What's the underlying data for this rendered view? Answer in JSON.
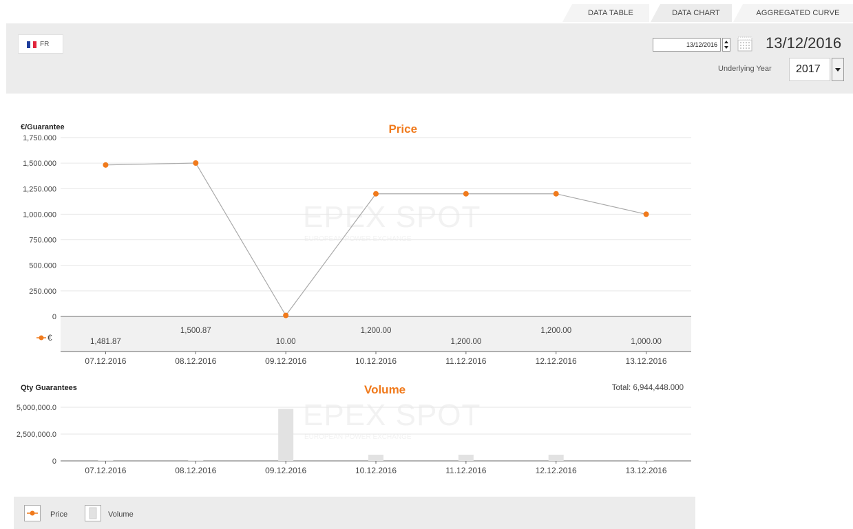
{
  "tabs": [
    "DATA TABLE",
    "DATA CHART",
    "AGGREGATED CURVE"
  ],
  "toolbar": {
    "country": "FR",
    "date_input": "13/12/2016",
    "date_display": "13/12/2016",
    "underlying_year_label": "Underlying Year",
    "underlying_year": "2017"
  },
  "colors": {
    "price": "#f07a1c",
    "volume": "#e2e2e2",
    "title": "#f07a1c"
  },
  "watermark": {
    "line1": "EPEX SPOT",
    "line2": "EUROPEAN POWER EXCHANGE"
  },
  "legend": {
    "price": "Price",
    "volume": "Volume"
  },
  "chart_data": [
    {
      "type": "line",
      "title": "Price",
      "ylabel": "€/Guarantee",
      "ylim": [
        0,
        1750
      ],
      "yticks": [
        "1,750.000",
        "1,500.000",
        "1,250.000",
        "1,000.000",
        "750.000",
        "500.000",
        "250.000",
        "0"
      ],
      "categories": [
        "07.12.2016",
        "08.12.2016",
        "09.12.2016",
        "10.12.2016",
        "11.12.2016",
        "12.12.2016",
        "13.12.2016"
      ],
      "series": [
        {
          "symbol": "€",
          "values": [
            1481.87,
            1500.87,
            10.0,
            1200.0,
            1200.0,
            1200.0,
            1000.0
          ],
          "labels": [
            "1,481.87",
            "1,500.87",
            "10.00",
            "1,200.00",
            "1,200.00",
            "1,200.00",
            "1,000.00"
          ]
        }
      ],
      "grid": true
    },
    {
      "type": "bar",
      "title": "Volume",
      "ylabel": "Qty Guarantees",
      "total_label": "Total: 6,944,448.000",
      "ylim": [
        0,
        5000000
      ],
      "yticks": [
        "5,000,000.0",
        "2,500,000.0",
        "0"
      ],
      "categories": [
        "07.12.2016",
        "08.12.2016",
        "09.12.2016",
        "10.12.2016",
        "11.12.2016",
        "12.12.2016",
        "13.12.2016"
      ],
      "series": [
        {
          "name": "Volume",
          "values": [
            60000,
            60000,
            4850000,
            580000,
            580000,
            580000,
            50000
          ]
        }
      ],
      "grid": true
    }
  ]
}
